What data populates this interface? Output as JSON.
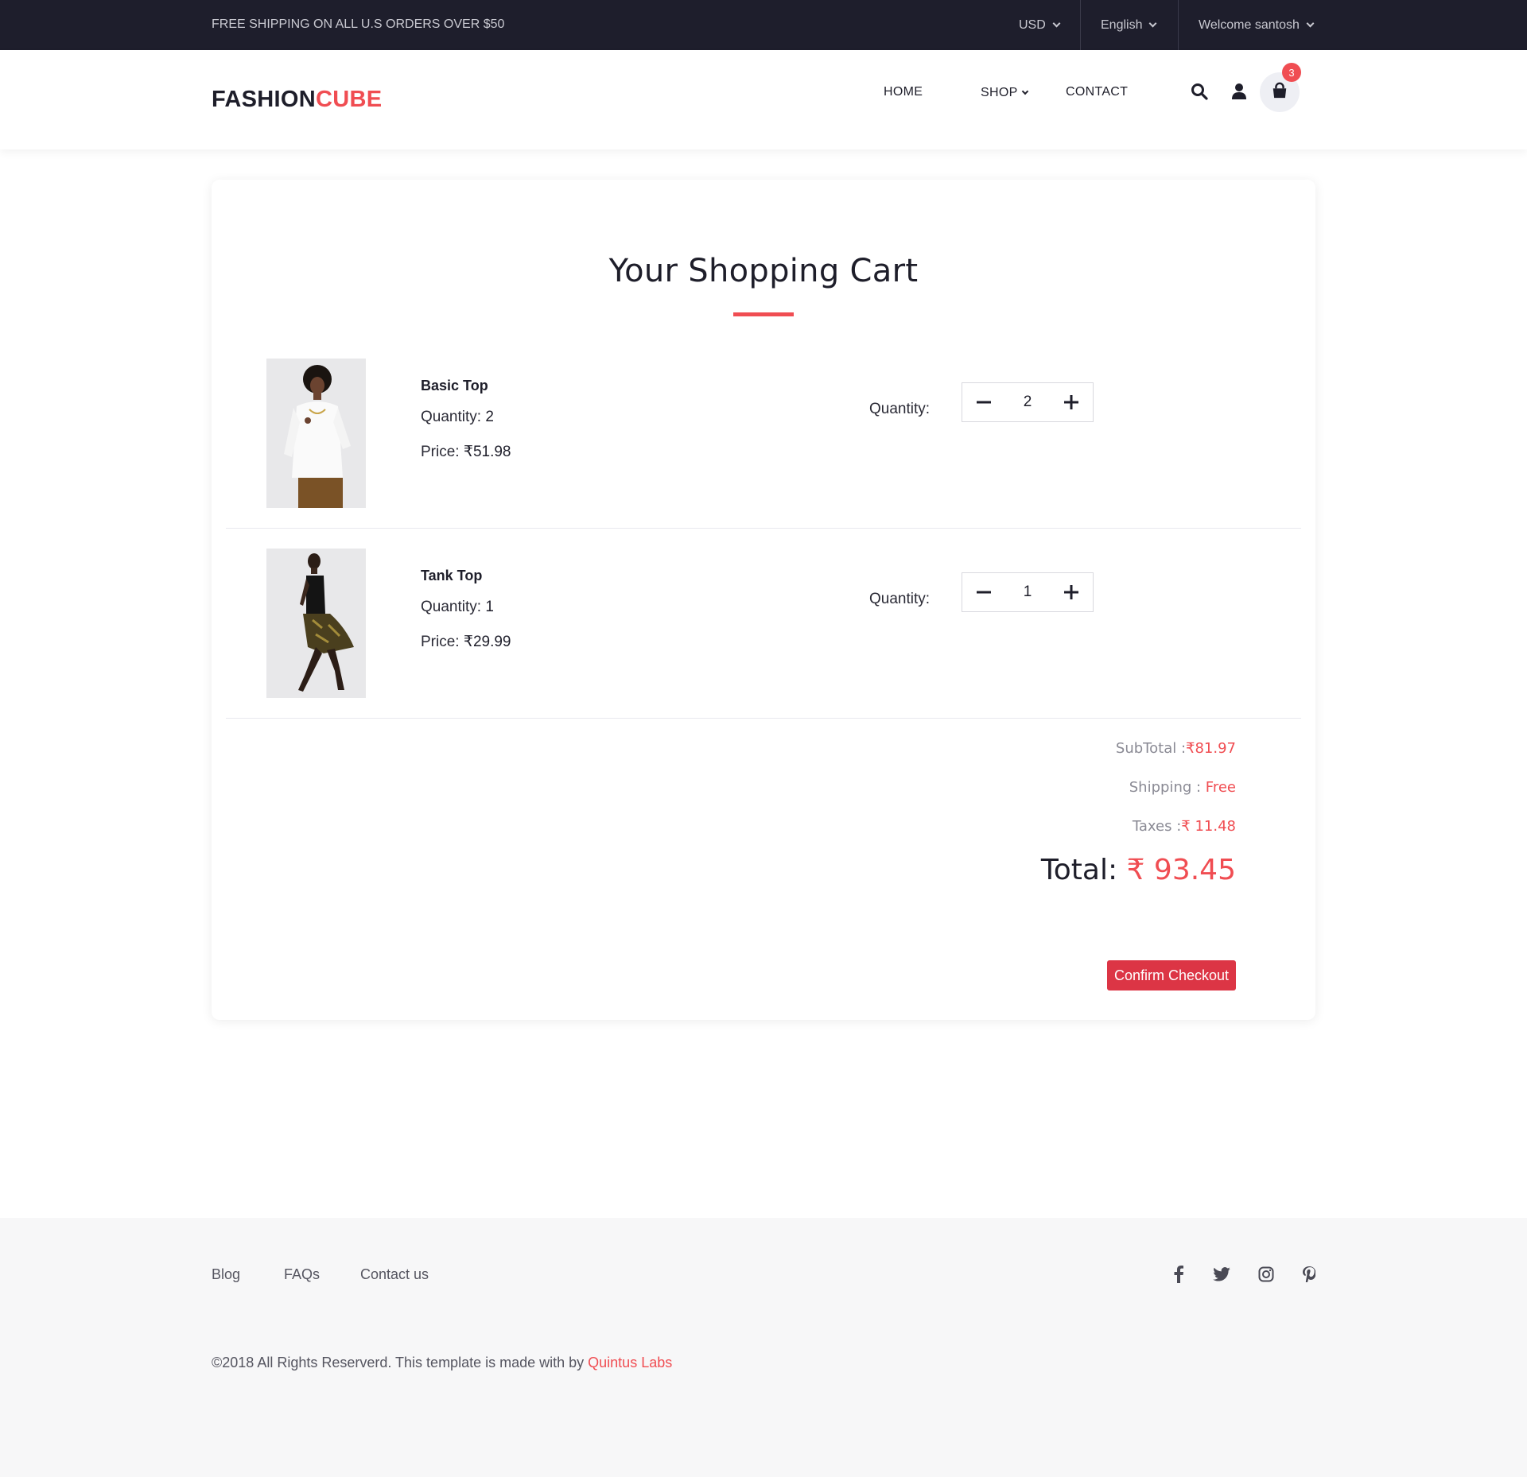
{
  "topbar": {
    "promo": "FREE SHIPPING ON ALL U.S ORDERS OVER $50",
    "currency": "USD",
    "language": "English",
    "account": "Welcome santosh"
  },
  "header": {
    "logo_part1": "FASHION",
    "logo_part2": "CUBE",
    "nav": {
      "home": "HOME",
      "shop": "SHOP",
      "contact": "CONTACT"
    },
    "icons": [
      "search-icon",
      "user-icon",
      "bag-icon"
    ],
    "cart_count": "3"
  },
  "cart": {
    "title": "Your Shopping Cart",
    "items": [
      {
        "name": "Basic Top",
        "quantity_label": "Quantity:",
        "quantity": "2",
        "price_label": "Price:",
        "price": "₹51.98",
        "control_label": "Quantity:"
      },
      {
        "name": "Tank Top",
        "quantity_label": "Quantity:",
        "quantity": "1",
        "price_label": "Price:",
        "price": "₹29.99",
        "control_label": "Quantity:"
      }
    ],
    "subtotal_label": "SubTotal :",
    "subtotal": "₹81.97",
    "shipping_label": "Shipping :",
    "shipping": "Free",
    "taxes_label": "Taxes :",
    "taxes": "₹ 11.48",
    "total_label": "Total:",
    "total": "₹ 93.45",
    "checkout": "Confirm Checkout"
  },
  "footer": {
    "links": [
      "Blog",
      "FAQs",
      "Contact us"
    ],
    "social": [
      "facebook-icon",
      "twitter-icon",
      "instagram-icon",
      "pinterest-icon"
    ],
    "copyright": "©2018 All Rights Reserverd. This template is made with  by",
    "credit": "Quintus Labs"
  },
  "colors": {
    "accent": "#f04d52",
    "topbar_bg": "#1e1e2c",
    "button": "#dc3545",
    "footer_bg": "#f7f7f8"
  }
}
